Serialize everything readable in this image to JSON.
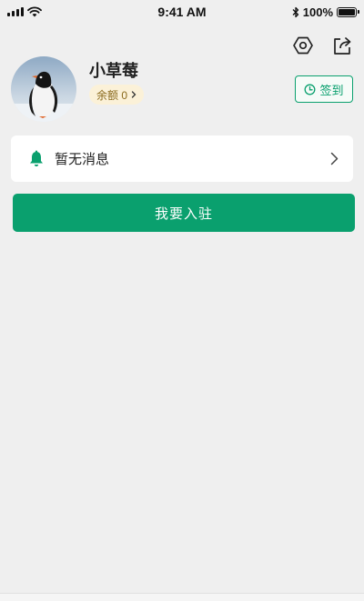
{
  "status_bar": {
    "time": "9:41 AM",
    "battery": "100%",
    "battery_level": 1.0
  },
  "header": {
    "settings_icon": "settings-hexagon-icon",
    "share_icon": "share-icon"
  },
  "profile": {
    "username": "小草莓",
    "balance_label": "余额 0",
    "checkin_label": "签到",
    "avatar_icon": "penguin-avatar"
  },
  "messages": {
    "label": "暂无消息"
  },
  "actions": {
    "join_label": "我要入驻"
  },
  "colors": {
    "accent": "#0aa06e",
    "background": "#efefef",
    "badge_bg": "#fbf1d8",
    "badge_text": "#8a6a1d"
  }
}
